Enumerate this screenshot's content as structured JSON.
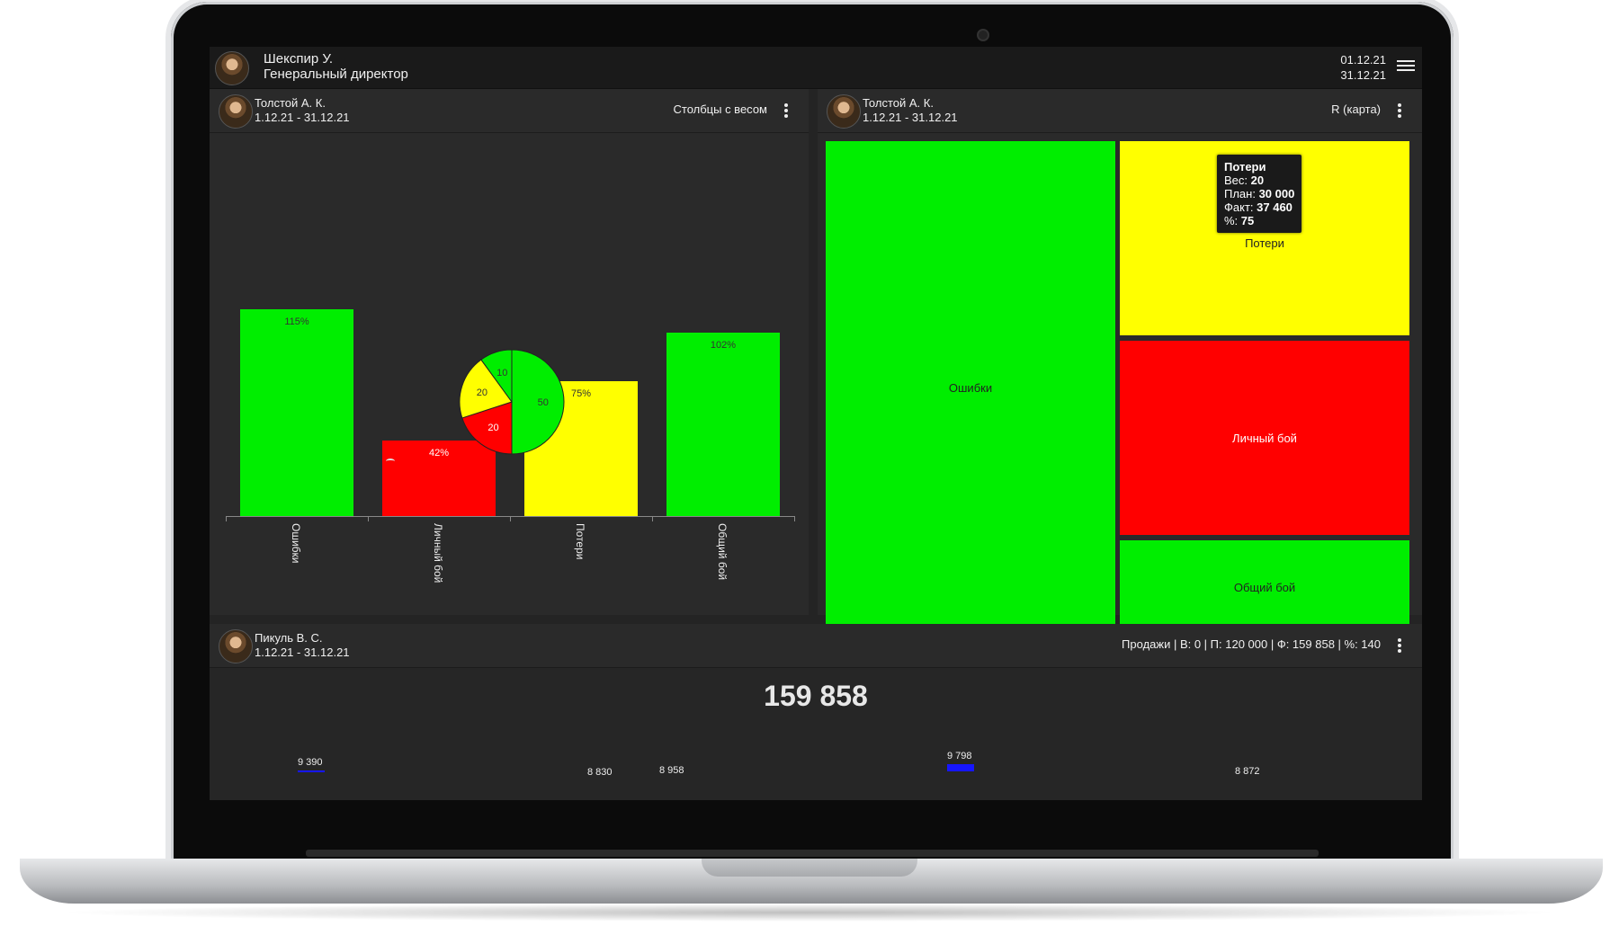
{
  "topbar": {
    "user_name": "Шекспир У.",
    "user_role": "Генеральный директор",
    "date_from": "01.12.21",
    "date_to": "31.12.21"
  },
  "left_panel": {
    "owner": "Толстой А. К.",
    "period": "1.12.21 - 31.12.21",
    "title": "Столбцы с весом"
  },
  "right_panel": {
    "owner": "Толстой А. К.",
    "period": "1.12.21 - 31.12.21",
    "title": "R (карта)"
  },
  "bottom_panel": {
    "owner": "Пикуль В. С.",
    "period": "1.12.21 - 31.12.21",
    "summary": "Продажи | В: 0 | П: 120 000 | Ф: 159 858 | %: 140",
    "total": "159 858",
    "spark_values": [
      "9 390",
      "8 830",
      "8 958",
      "9 798",
      "8 872"
    ]
  },
  "colors": {
    "green": "#00ee00",
    "red": "#ff0000",
    "yellow": "#ffff00",
    "blue": "#1616ff"
  },
  "chart_data": [
    {
      "type": "bar",
      "categories": [
        "Ошибки",
        "Личный бой",
        "Потери",
        "Общий бой"
      ],
      "values": [
        115,
        42,
        75,
        102
      ],
      "value_labels": [
        "115%",
        "42%",
        "75%",
        "102%"
      ],
      "bar_colors": [
        "#00ee00",
        "#ff0000",
        "#ffff00",
        "#00ee00"
      ],
      "ylim": [
        0,
        130
      ]
    },
    {
      "type": "pie",
      "slices": [
        {
          "label": "50",
          "value": 50,
          "color": "#00ee00"
        },
        {
          "label": "20",
          "value": 20,
          "color": "#ff0000"
        },
        {
          "label": "20",
          "value": 20,
          "color": "#ffff00"
        },
        {
          "label": "10",
          "value": 10,
          "color": "#00ee00"
        }
      ]
    },
    {
      "type": "heatmap",
      "cells": [
        {
          "label": "Ошибки",
          "color": "#00ee00"
        },
        {
          "label": "Потери",
          "color": "#ffff00"
        },
        {
          "label": "Личный бой",
          "color": "#ff0000"
        },
        {
          "label": "Общий бой",
          "color": "#00ee00"
        }
      ],
      "tooltip": {
        "title": "Потери",
        "weight_label": "Вес:",
        "weight": "20",
        "plan_label": "План:",
        "plan": "30 000",
        "fact_label": "Факт:",
        "fact": "37 460",
        "pct_label": "%:",
        "pct": "75"
      }
    }
  ]
}
